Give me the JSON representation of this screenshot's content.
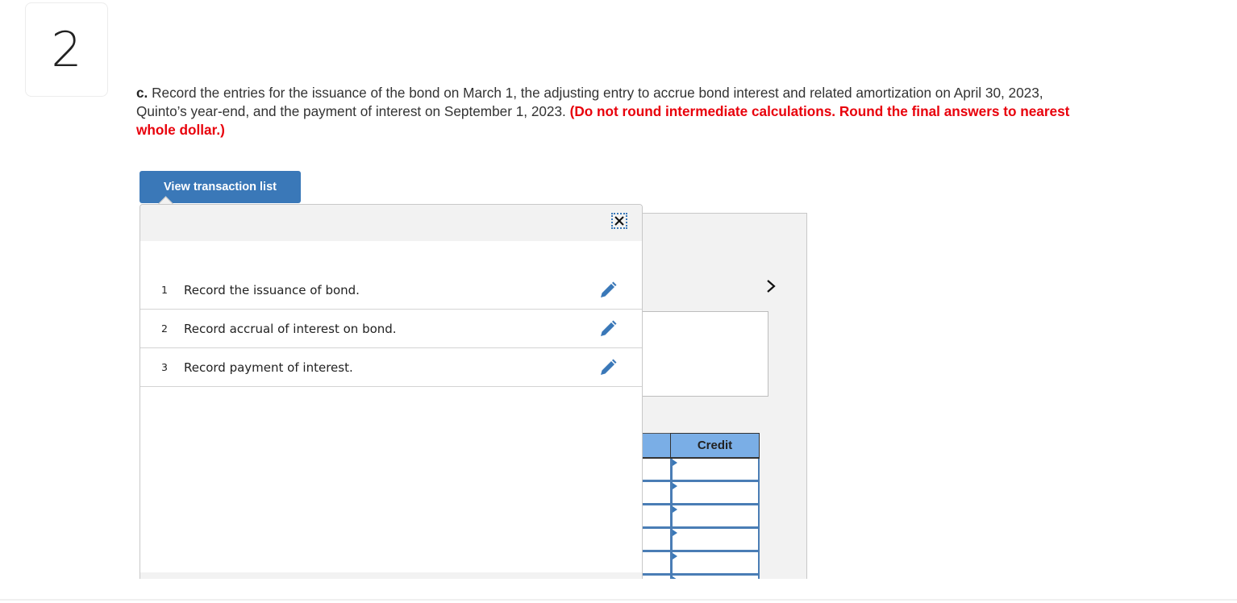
{
  "question": {
    "number": "2",
    "part_label": "c.",
    "text": " Record the entries for the issuance of the bond on March 1, the adjusting entry to accrue bond interest and related amortization on April 30, 2023, Quinto’s year-end, and the payment of interest on September 1, 2023. ",
    "instruction": "(Do not round intermediate calculations. Round the final answers to nearest whole dollar.)"
  },
  "toolbar": {
    "view_transaction_list_label": "View transaction list"
  },
  "icons": {
    "close": "close-icon",
    "edit": "pencil-icon",
    "next": "chevron-right-icon"
  },
  "transaction_list": {
    "items": [
      {
        "number": "1",
        "label": "Record the issuance of bond."
      },
      {
        "number": "2",
        "label": "Record accrual of interest on bond."
      },
      {
        "number": "3",
        "label": "Record payment of interest."
      }
    ]
  },
  "journal": {
    "columns": {
      "credit": "Credit"
    },
    "rows": [
      {
        "credit": ""
      },
      {
        "credit": ""
      },
      {
        "credit": ""
      },
      {
        "credit": ""
      },
      {
        "credit": ""
      }
    ]
  },
  "colors": {
    "accent": "#3a78b8",
    "instruction_red": "#e8000b",
    "table_header": "#7aaee6"
  }
}
